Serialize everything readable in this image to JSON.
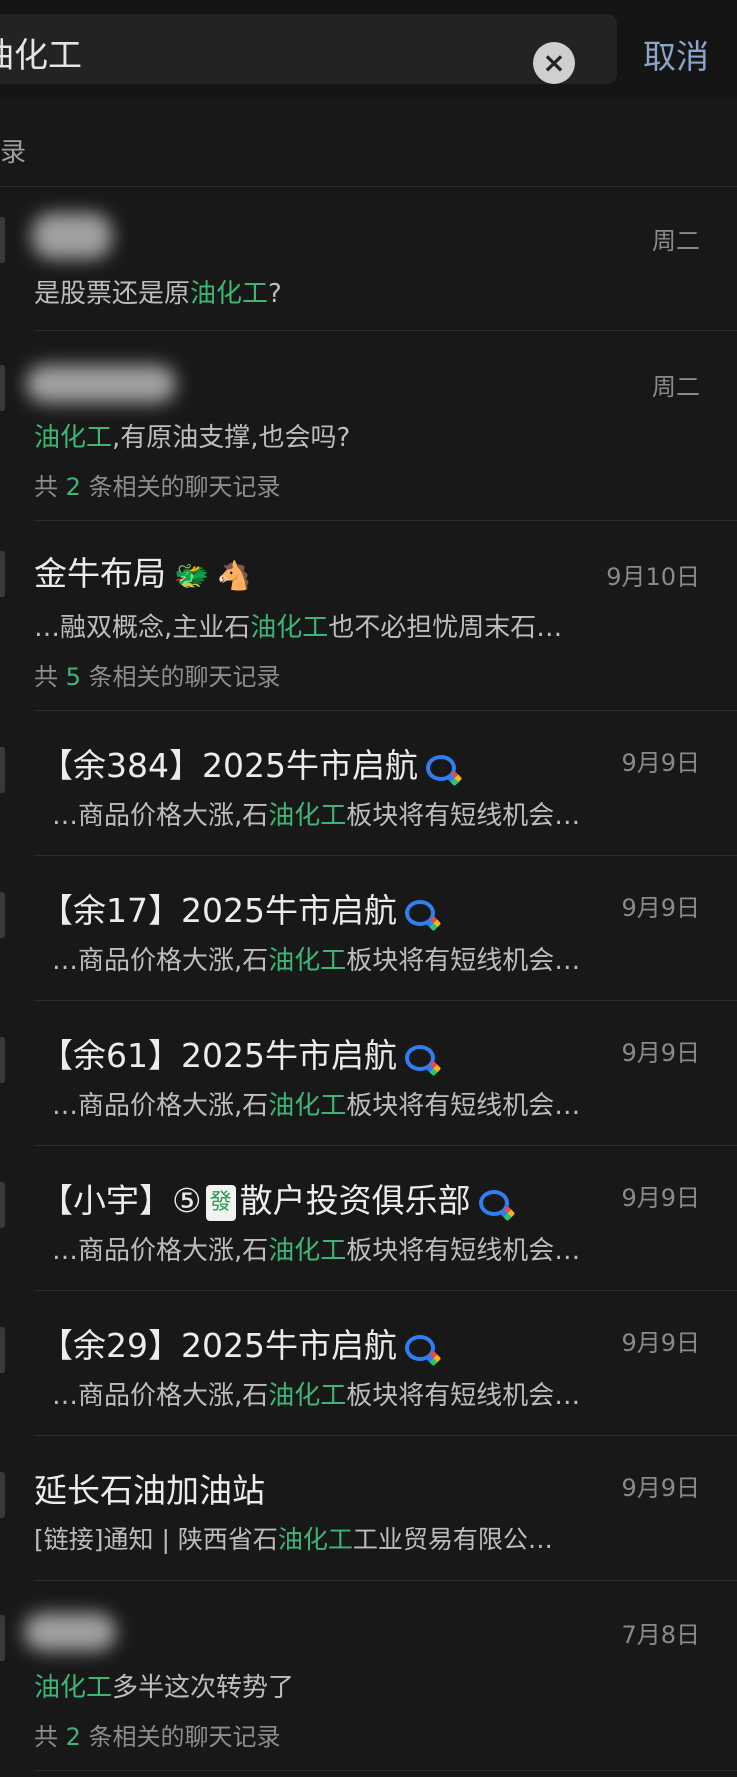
{
  "search": {
    "query": "油化工",
    "cancel_label": "取消",
    "clear_icon": "close-circle-icon"
  },
  "section_title": "录",
  "accent_color": "#3eb575",
  "results": [
    {
      "name": "",
      "date": "周二",
      "snippet_pre": "是股票还是原",
      "snippet_hl": "油化工",
      "snippet_post": "?",
      "count_pre": "",
      "count_num": "",
      "count_post": ""
    },
    {
      "name": "",
      "date": "周二",
      "snippet_pre": "",
      "snippet_hl": "油化工",
      "snippet_post": ",有原油支撑,也会吗?",
      "count_pre": "共 ",
      "count_num": "2",
      "count_post": " 条相关的聊天记录"
    },
    {
      "name": "金牛布局",
      "date": "9月10日",
      "snippet_pre": "…融双概念,主业石",
      "snippet_hl": "油化工",
      "snippet_post": "也不必担忧周末石…",
      "count_pre": "共 ",
      "count_num": "5",
      "count_post": " 条相关的聊天记录",
      "emoji1": "🐲",
      "emoji2": "🐴"
    },
    {
      "name": "【余384】2025牛市启航",
      "date": "9月9日",
      "snippet_pre": "…商品价格大涨,石",
      "snippet_hl": "油化工",
      "snippet_post": "板块将有短线机会…"
    },
    {
      "name": "【余17】2025牛市启航",
      "date": "9月9日",
      "snippet_pre": "…商品价格大涨,石",
      "snippet_hl": "油化工",
      "snippet_post": "板块将有短线机会…"
    },
    {
      "name": "【余61】2025牛市启航",
      "date": "9月9日",
      "snippet_pre": "…商品价格大涨,石",
      "snippet_hl": "油化工",
      "snippet_post": "板块将有短线机会…"
    },
    {
      "name_pre": "【小宇】⑤",
      "tile": "發",
      "name_post": "散户投资俱乐部",
      "date": "9月9日",
      "snippet_pre": "…商品价格大涨,石",
      "snippet_hl": "油化工",
      "snippet_post": "板块将有短线机会…"
    },
    {
      "name": "【余29】2025牛市启航",
      "date": "9月9日",
      "snippet_pre": "…商品价格大涨,石",
      "snippet_hl": "油化工",
      "snippet_post": "板块将有短线机会…"
    },
    {
      "name": "延长石油加油站",
      "date": "9月9日",
      "snippet_pre": "[链接]通知 | 陕西省石",
      "snippet_hl": "油化工",
      "snippet_post": "工业贸易有限公…"
    },
    {
      "name": "",
      "date": "7月8日",
      "snippet_pre": "",
      "snippet_hl": "油化工",
      "snippet_post": "多半这次转势了",
      "count_pre": "共 ",
      "count_num": "2",
      "count_post": " 条相关的聊天记录"
    }
  ]
}
